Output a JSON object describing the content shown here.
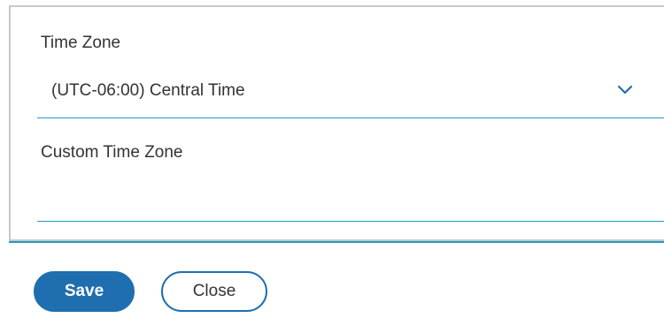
{
  "form": {
    "time_zone": {
      "label": "Time Zone",
      "selected_value": "(UTC-06:00) Central Time",
      "icon": "chevron-down-icon"
    },
    "custom_time_zone": {
      "label": "Custom Time Zone",
      "value": ""
    }
  },
  "actions": {
    "save_label": "Save",
    "close_label": "Close"
  },
  "colors": {
    "accent": "#1f9bc4",
    "primary_button": "#1f6fb0",
    "text": "#333333",
    "panel_border": "#c8c8c8"
  }
}
